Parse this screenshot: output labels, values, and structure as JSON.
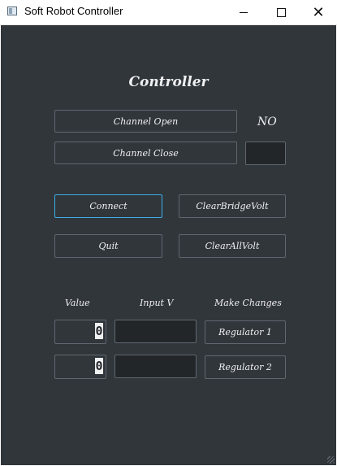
{
  "window": {
    "title": "Soft Robot Controller",
    "minimize_icon": "minimize-icon",
    "maximize_icon": "maximize-icon",
    "close_icon": "close-icon",
    "close_glyph": "✕"
  },
  "main": {
    "heading": "Controller",
    "channel_open_label": "Channel Open",
    "channel_close_label": "Channel Close",
    "channel_status": "NO",
    "connect_label": "Connect",
    "clear_bridge_label": "ClearBridgeVolt",
    "quit_label": "Quit",
    "clear_all_label": "ClearAllVolt"
  },
  "regulators": {
    "headers": {
      "value": "Value",
      "input": "Input V",
      "changes": "Make Changes"
    },
    "rows": [
      {
        "value": "0",
        "input": "",
        "button": "Regulator 1"
      },
      {
        "value": "0",
        "input": "",
        "button": "Regulator 2"
      }
    ]
  },
  "theme": {
    "background": "#31363b",
    "field": "#232629",
    "border": "#5f6770",
    "focus": "#3daee9",
    "text": "#eff0f1"
  }
}
